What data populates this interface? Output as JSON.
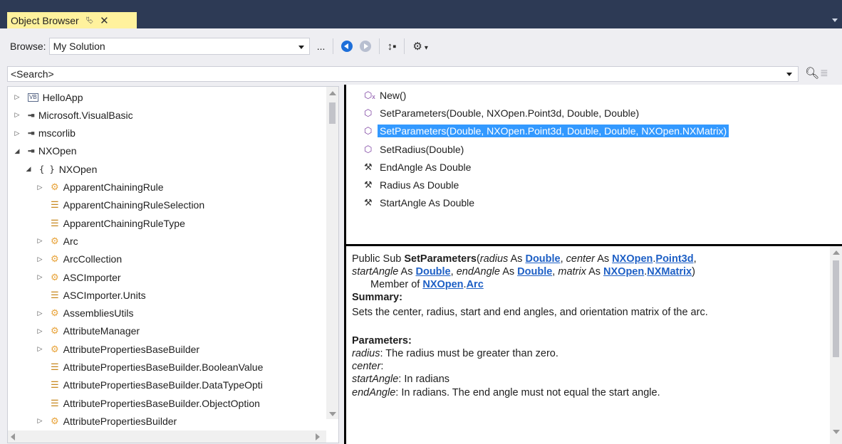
{
  "window": {
    "tab_title": "Object Browser",
    "pin_icon": "pin-icon",
    "close_icon": "close-icon"
  },
  "toolbar": {
    "browse_label": "Browse:",
    "browse_value": "My Solution",
    "ellipsis_label": "..."
  },
  "search": {
    "placeholder": "<Search>"
  },
  "tree": [
    {
      "label": "HelloApp",
      "icon": "vb-project-icon",
      "expander": "collapsed",
      "level": 0
    },
    {
      "label": "Microsoft.VisualBasic",
      "icon": "assembly-icon",
      "expander": "collapsed",
      "level": 0
    },
    {
      "label": "mscorlib",
      "icon": "assembly-icon",
      "expander": "collapsed",
      "level": 0
    },
    {
      "label": "NXOpen",
      "icon": "assembly-icon",
      "expander": "expanded",
      "level": 0
    },
    {
      "label": "NXOpen",
      "icon": "namespace-icon",
      "expander": "expanded",
      "level": 1
    },
    {
      "label": "ApparentChainingRule",
      "icon": "class-icon",
      "expander": "collapsed",
      "level": 2
    },
    {
      "label": "ApparentChainingRuleSelection",
      "icon": "enum-icon",
      "expander": "none",
      "level": 2
    },
    {
      "label": "ApparentChainingRuleType",
      "icon": "enum-icon",
      "expander": "none",
      "level": 2
    },
    {
      "label": "Arc",
      "icon": "class-icon",
      "expander": "collapsed",
      "level": 2
    },
    {
      "label": "ArcCollection",
      "icon": "class-icon",
      "expander": "collapsed",
      "level": 2
    },
    {
      "label": "ASCImporter",
      "icon": "class-icon",
      "expander": "collapsed",
      "level": 2
    },
    {
      "label": "ASCImporter.Units",
      "icon": "enum-icon",
      "expander": "none",
      "level": 2
    },
    {
      "label": "AssembliesUtils",
      "icon": "class-icon",
      "expander": "collapsed",
      "level": 2
    },
    {
      "label": "AttributeManager",
      "icon": "class-icon",
      "expander": "collapsed",
      "level": 2
    },
    {
      "label": "AttributePropertiesBaseBuilder",
      "icon": "class-icon",
      "expander": "collapsed",
      "level": 2
    },
    {
      "label": "AttributePropertiesBaseBuilder.BooleanValue",
      "icon": "enum-icon",
      "expander": "none",
      "level": 2
    },
    {
      "label": "AttributePropertiesBaseBuilder.DataTypeOpti",
      "icon": "enum-icon",
      "expander": "none",
      "level": 2
    },
    {
      "label": "AttributePropertiesBaseBuilder.ObjectOption",
      "icon": "enum-icon",
      "expander": "none",
      "level": 2
    },
    {
      "label": "AttributePropertiesBuilder",
      "icon": "class-icon",
      "expander": "collapsed",
      "level": 2
    }
  ],
  "members": [
    {
      "label": "New()",
      "icon": "constructor-icon",
      "selected": false
    },
    {
      "label": "SetParameters(Double, NXOpen.Point3d, Double, Double)",
      "icon": "method-icon",
      "selected": false
    },
    {
      "label": "SetParameters(Double, NXOpen.Point3d, Double, Double, NXOpen.NXMatrix)",
      "icon": "method-icon",
      "selected": true
    },
    {
      "label": "SetRadius(Double)",
      "icon": "method-icon",
      "selected": false
    },
    {
      "label": "EndAngle As Double",
      "icon": "property-icon",
      "selected": false
    },
    {
      "label": "Radius As Double",
      "icon": "property-icon",
      "selected": false
    },
    {
      "label": "StartAngle As Double",
      "icon": "property-icon",
      "selected": false
    }
  ],
  "details": {
    "l1_a": "Public Sub ",
    "l1_name": "SetParameters",
    "l1_b": "(",
    "p_radius": "radius",
    "as1": " As ",
    "t_double": "Double",
    "comma": ", ",
    "p_center": "center",
    "t_nxopen": "NXOpen",
    "dot": ".",
    "t_point3d": "Point3d",
    "l2_comma": ",",
    "p_start": "startAngle",
    "p_end": "endAngle",
    "p_matrix": "matrix",
    "t_nxmatrix": "NXMatrix",
    "close": ")",
    "member_of": "Member of ",
    "t_arc": "Arc",
    "summary_heading": "Summary:",
    "summary_text": "Sets the center, radius, start and end angles, and orientation matrix of the arc.",
    "params_heading": "Parameters:",
    "radius_desc": ": The radius must be greater than zero.",
    "center_desc": ":",
    "start_desc": ": In radians",
    "end_desc": ": In radians. The end angle must not equal the start angle."
  },
  "colors": {
    "title_bg": "#2d3a55",
    "tab_bg": "#fff29d",
    "selection": "#3399ff",
    "link": "#1d5fc5"
  }
}
